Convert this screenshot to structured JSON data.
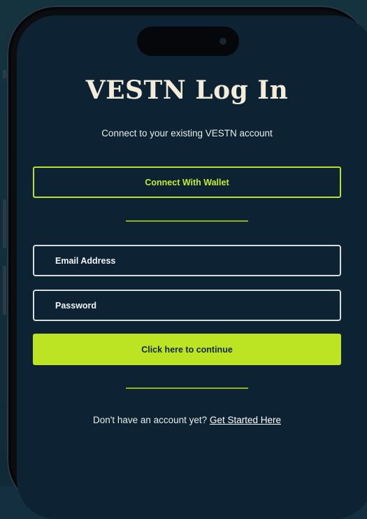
{
  "page": {
    "title": "VESTN Log In",
    "subtitle": "Connect to your existing VESTN account"
  },
  "wallet": {
    "label": "Connect With Wallet"
  },
  "form": {
    "email_placeholder": "Email Address",
    "email_value": "",
    "password_placeholder": "Password",
    "password_value": "",
    "continue_label": "Click here to continue"
  },
  "footer": {
    "prompt": "Don't have an account yet?",
    "link_label": "Get Started Here"
  },
  "colors": {
    "background": "#0d2333",
    "accent": "#bde423",
    "title": "#f3ecd8"
  }
}
